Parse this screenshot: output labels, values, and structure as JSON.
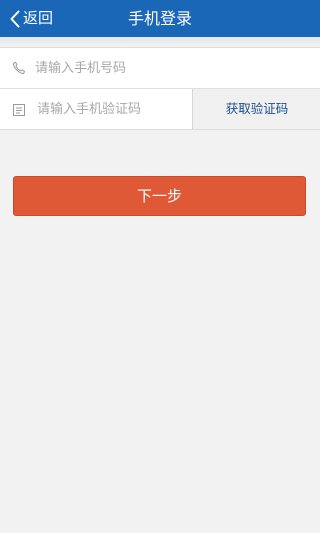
{
  "header": {
    "back_label": "返回",
    "title": "手机登录"
  },
  "form": {
    "phone": {
      "icon": "phone-icon",
      "placeholder": "请输入手机号码",
      "value": ""
    },
    "code": {
      "icon": "document-icon",
      "placeholder": "请输入手机验证码",
      "value": "",
      "get_code_label": "获取验证码"
    }
  },
  "actions": {
    "next_label": "下一步"
  },
  "colors": {
    "header_bg": "#1a66b7",
    "primary_button": "#df5936",
    "link_text": "#1a4f8c",
    "background": "#f2f2f2"
  }
}
